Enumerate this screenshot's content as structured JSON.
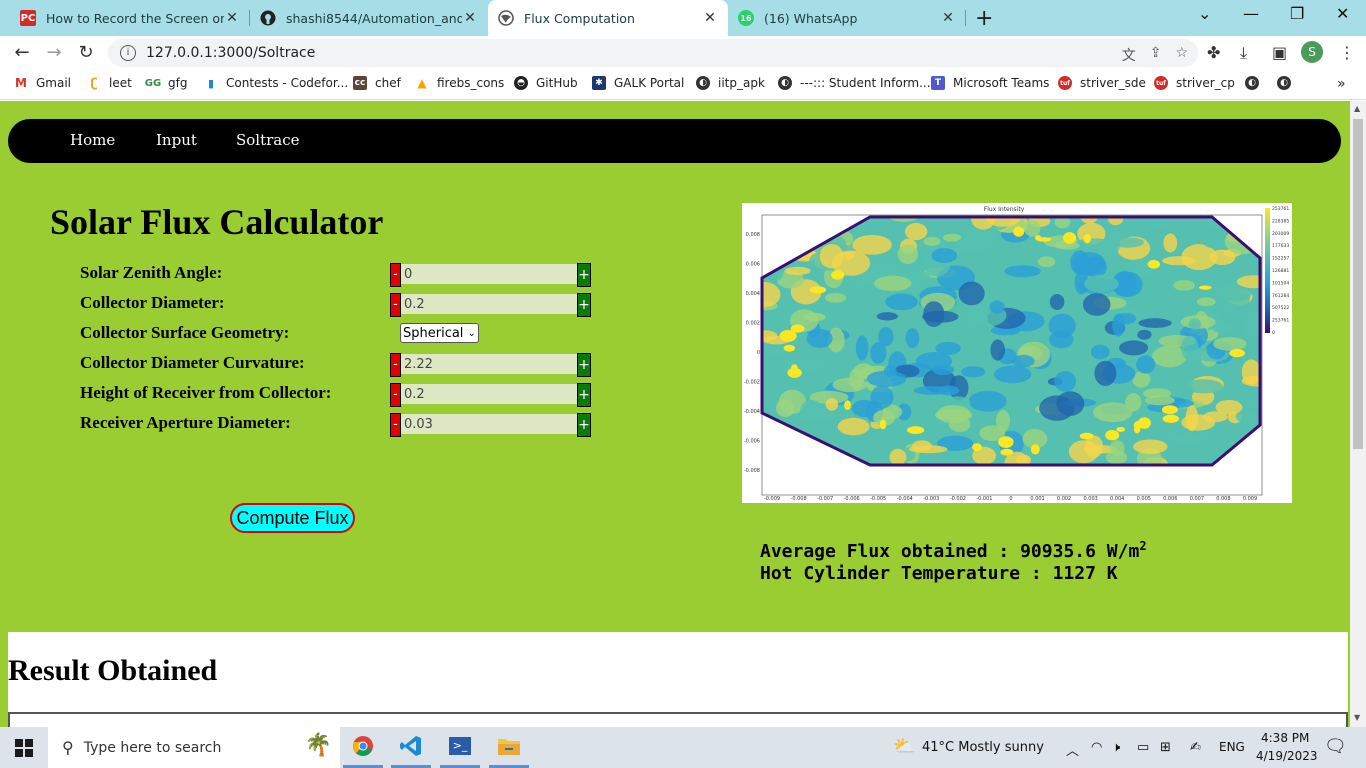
{
  "tabs": [
    {
      "title": "How to Record the Screen on You",
      "icon": "pcmag-icon",
      "active": false
    },
    {
      "title": "shashi8544/Automation_and_Sol",
      "icon": "github-icon",
      "active": false
    },
    {
      "title": "Flux Computation",
      "icon": "globe-icon",
      "active": true
    },
    {
      "title": "(16) WhatsApp",
      "icon": "whatsapp-icon",
      "active": false
    }
  ],
  "address": {
    "url": "127.0.0.1:3000/Soltrace"
  },
  "profile_initial": "S",
  "bookmarks": [
    {
      "label": "Gmail"
    },
    {
      "label": "leet"
    },
    {
      "label": "gfg"
    },
    {
      "label": "Contests - Codefor..."
    },
    {
      "label": "chef"
    },
    {
      "label": "firebs_cons"
    },
    {
      "label": "GitHub"
    },
    {
      "label": "GALK Portal"
    },
    {
      "label": "iitp_apk"
    },
    {
      "label": "---::: Student Inform..."
    },
    {
      "label": "Microsoft Teams"
    },
    {
      "label": "striver_sde"
    },
    {
      "label": "striver_cp"
    }
  ],
  "nav": {
    "home": "Home",
    "input": "Input",
    "soltrace": "Soltrace"
  },
  "calculator": {
    "title": "Solar Flux Calculator",
    "fields": [
      {
        "label": "Solar Zenith Angle:",
        "value": "0"
      },
      {
        "label": "Collector Diameter:",
        "value": "0.2"
      },
      {
        "label": "Collector Surface Geometry:",
        "selected": "Spherical"
      },
      {
        "label": "Collector Diameter Curvature:",
        "value": "2.22"
      },
      {
        "label": "Height of Receiver from Collector:",
        "value": "0.2"
      },
      {
        "label": "Receiver Aperture Diameter:",
        "value": "0.03"
      }
    ],
    "minus": "-",
    "plus": "+",
    "compute_label": "Compute Flux"
  },
  "chart_data": {
    "type": "heatmap",
    "title": "Flux Intensity",
    "x_ticks": [
      "-0.009",
      "-0.008",
      "-0.007",
      "-0.006",
      "-0.005",
      "-0.004",
      "-0.003",
      "-0.002",
      "-0.001",
      "0",
      "0.001",
      "0.002",
      "0.003",
      "0.004",
      "0.005",
      "0.006",
      "0.007",
      "0.008",
      "0.009"
    ],
    "y_ticks": [
      "0.008",
      "0.006",
      "0.004",
      "0.002",
      "0",
      "-0.002",
      "-0.004",
      "-0.006",
      "-0.008"
    ],
    "colorbar_ticks": [
      "253761",
      "228385",
      "203009",
      "177633",
      "152257",
      "126881",
      "101504",
      "761284",
      "507522",
      "253761",
      "0"
    ],
    "colormap": [
      "#3b0f70",
      "#2166ac",
      "#2b9fd8",
      "#55c0b0",
      "#9bd47f",
      "#f6d44a",
      "#fde725"
    ]
  },
  "results": {
    "flux_prefix": "Average Flux obtained : ",
    "flux_value": "90935.6",
    "flux_unit": " W/m",
    "flux_sup": "2",
    "temp_text": "Hot Cylinder Temperature : 1127 K"
  },
  "result_section": {
    "title": "Result Obtained"
  },
  "taskbar": {
    "search_placeholder": "Type here to search",
    "weather": "41°C  Mostly sunny",
    "lang": "ENG",
    "time": "4:38 PM",
    "date": "4/19/2023"
  }
}
